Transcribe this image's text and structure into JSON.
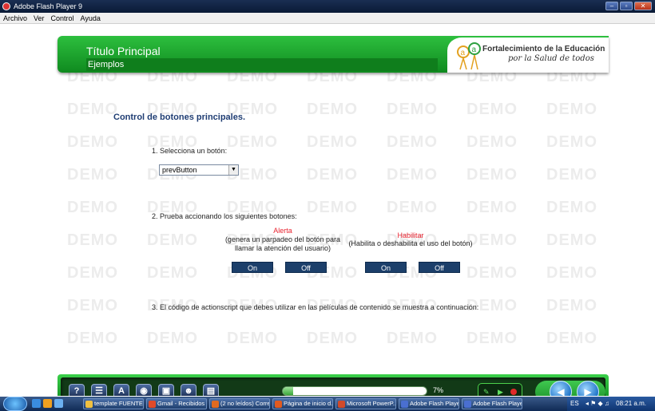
{
  "window": {
    "title": "Adobe Flash Player 9"
  },
  "menu": [
    "Archivo",
    "Ver",
    "Control",
    "Ayuda"
  ],
  "header": {
    "title": "Título Principal",
    "subtitle": "Ejemplos",
    "logo_line1": "Fortalecimiento de la Educación",
    "logo_line2": "por la Salud de todos"
  },
  "watermark_text": "DEMO",
  "content": {
    "title": "Control de botones principales.",
    "step1": "1. Selecciona un botón:",
    "select_value": "prevButton",
    "step2": "2. Prueba accionando los siguientes botones:",
    "alerta": {
      "label": "Alerta",
      "desc1": "(genera un parpadeo del botón para",
      "desc2": "llamar la atención del usuario)",
      "on": "On",
      "off": "Off"
    },
    "habilitar": {
      "label": "Habilitar",
      "desc": "(Habilita o deshabilita el uso del botón)",
      "on": "On",
      "off": "Off"
    },
    "step3": "3. El código de actionscript que debes utilizar en las películas de contenido se muestra a continuación:"
  },
  "footer": {
    "tools": [
      "?",
      "☰",
      "A",
      "◉",
      "▣",
      "☻",
      "▤"
    ],
    "progress_text": "7%",
    "progress_fraction": 0.07
  },
  "taskbar": {
    "tasks": [
      "template FUENTE...",
      "Gmail - Recibidos ...",
      "(2 no leídos) Corre...",
      "Página de inicio d...",
      "Microsoft PowerP...",
      "Adobe Flash Playe...",
      "Adobe Flash Playe..."
    ],
    "tray_lang": "ES",
    "clock": "08:21 a.m."
  },
  "colors": {
    "header_green": "#1aa52d",
    "button_navy": "#1c3f6a",
    "accent_red": "#e8232f",
    "title_blue": "#1f3d73"
  }
}
